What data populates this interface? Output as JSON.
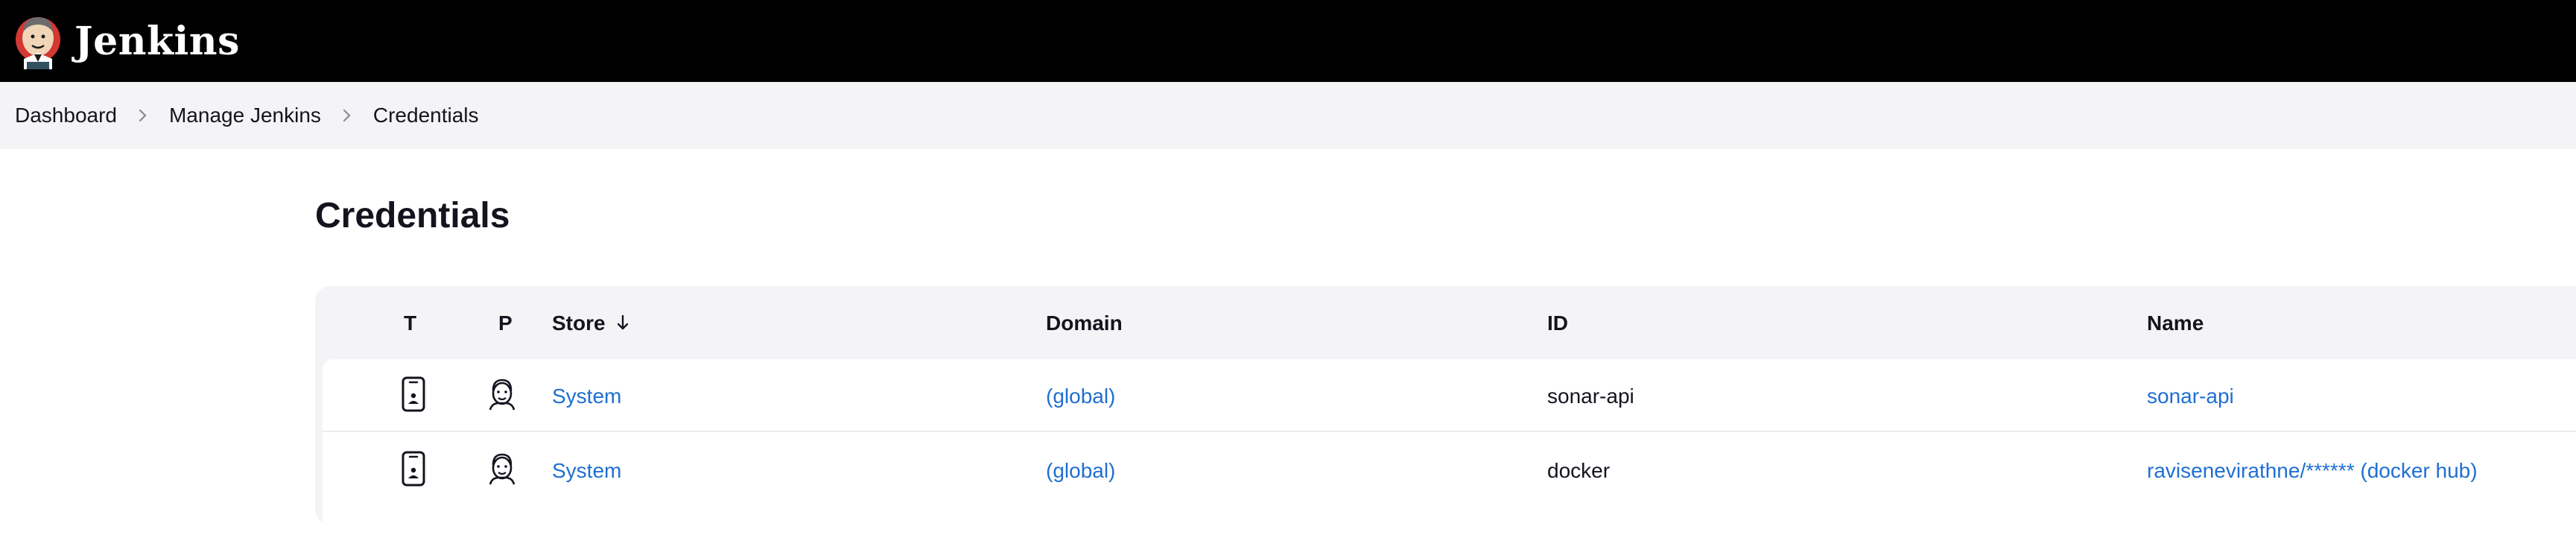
{
  "header": {
    "app_name": "Jenkins",
    "logo_icon": "jenkins-butler-logo",
    "background_color": "#000000"
  },
  "breadcrumb": {
    "items": [
      {
        "label": "Dashboard"
      },
      {
        "label": "Manage Jenkins"
      },
      {
        "label": "Credentials"
      }
    ],
    "separator_icon": "chevron-right-icon"
  },
  "page": {
    "title": "Credentials"
  },
  "table": {
    "columns": {
      "t": "T",
      "p": "P",
      "store": "Store",
      "domain": "Domain",
      "id": "ID",
      "name": "Name"
    },
    "sort": {
      "column": "Store",
      "direction": "descending",
      "icon": "arrow-down-icon"
    },
    "rows": [
      {
        "type_icon": "mobile-user-credential-icon",
        "provider_icon": "jenkins-provider-icon",
        "store": "System",
        "domain": "(global)",
        "id": "sonar-api",
        "name": "sonar-api"
      },
      {
        "type_icon": "mobile-user-credential-icon",
        "provider_icon": "jenkins-provider-icon",
        "store": "System",
        "domain": "(global)",
        "id": "docker",
        "name": "ravisenevirathne/****** (docker hub)"
      }
    ]
  },
  "colors": {
    "link": "#1f6fd1",
    "breadcrumb_bg": "#f4f4f6",
    "table_header_bg": "#f4f4f6"
  }
}
